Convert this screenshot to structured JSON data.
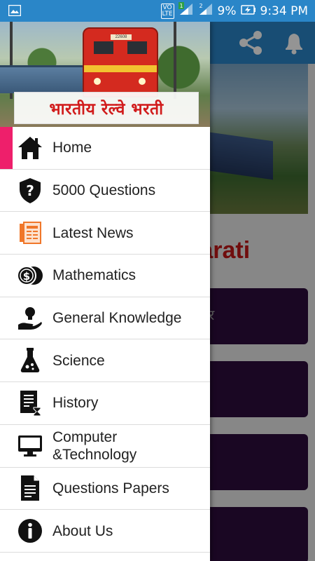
{
  "status_bar": {
    "network_badge_top": "VO",
    "network_badge_bottom": "LTE",
    "sim1": "1",
    "sim2": "2",
    "battery": "9%",
    "time": "9:34 PM"
  },
  "drawer": {
    "header_title": "भारतीय रेल्वे भरती",
    "header_loco_number": "22608",
    "items": [
      {
        "label": "Home",
        "icon": "home-icon",
        "active": true
      },
      {
        "label": "5000 Questions",
        "icon": "shield-question-icon"
      },
      {
        "label": "Latest News",
        "icon": "newspaper-icon"
      },
      {
        "label": "Mathematics",
        "icon": "coins-icon"
      },
      {
        "label": "General Knowledge",
        "icon": "idea-hand-icon"
      },
      {
        "label": "Science",
        "icon": "flask-icon"
      },
      {
        "label": "History",
        "icon": "document-hourglass-icon"
      },
      {
        "label": "Computer\n&Technology",
        "icon": "monitor-icon"
      },
      {
        "label": "Questions Papers",
        "icon": "document-icon"
      },
      {
        "label": "About Us",
        "icon": "info-icon"
      }
    ]
  },
  "background": {
    "title_fragment": "Bharati",
    "card_text_fragment": "र"
  },
  "colors": {
    "toolbar": "#2a86c8",
    "active_indicator": "#ee1f6b",
    "card": "#2e0d3d",
    "title": "#c21818"
  }
}
